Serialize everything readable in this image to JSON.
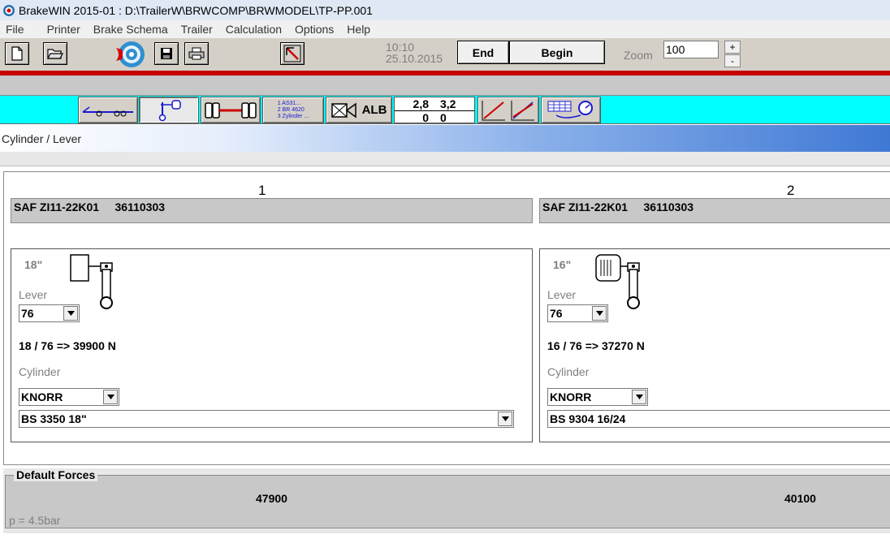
{
  "window": {
    "title": "BrakeWIN 2015-01 : D:\\TrailerW\\BRWCOMP\\BRWMODEL\\TP-PP.001"
  },
  "menu": [
    "File",
    "Printer",
    "Brake Schema",
    "Trailer",
    "Calculation",
    "Options",
    "Help"
  ],
  "toolbar": {
    "time": "10:10",
    "date": "25.10.2015",
    "end_label": "End",
    "begin_label": "Begin",
    "zoom_label": "Zoom",
    "zoom_value": "100",
    "zoom_plus": "+",
    "zoom_minus": "-"
  },
  "cyan_toolbar": {
    "list_lines": [
      "1 AS31...",
      "2 BR 4620",
      "3 Zylinder ..."
    ],
    "alb_label": "ALB",
    "ratio_top": [
      "2,8",
      "3,2"
    ],
    "ratio_bottom": [
      "0",
      "0"
    ]
  },
  "section": {
    "title": "Cylinder / Lever"
  },
  "columns": [
    {
      "number": "1",
      "model": "SAF ZI11-22K01     36110303",
      "size": "18\"",
      "lever_label": "Lever",
      "lever_value": "76",
      "formula": "18 / 76 => 39900 N",
      "cylinder_label": "Cylinder",
      "manufacturer": "KNORR",
      "cylinder_model": "BS 3350 18\""
    },
    {
      "number": "2",
      "model": "SAF ZI11-22K01     36110303",
      "size": "16\"",
      "lever_label": "Lever",
      "lever_value": "76",
      "formula": "16 / 76 => 37270 N",
      "cylinder_label": "Cylinder",
      "manufacturer": "KNORR",
      "cylinder_model": "BS 9304 16/24"
    }
  ],
  "forces": {
    "legend": "Default Forces",
    "values": [
      "47900",
      "40100"
    ],
    "pressure": "p = 4.5bar"
  },
  "colors": {
    "cyan_bar": "#00ffff",
    "red_line": "#c40000",
    "header_blue": "#3f78d4"
  }
}
